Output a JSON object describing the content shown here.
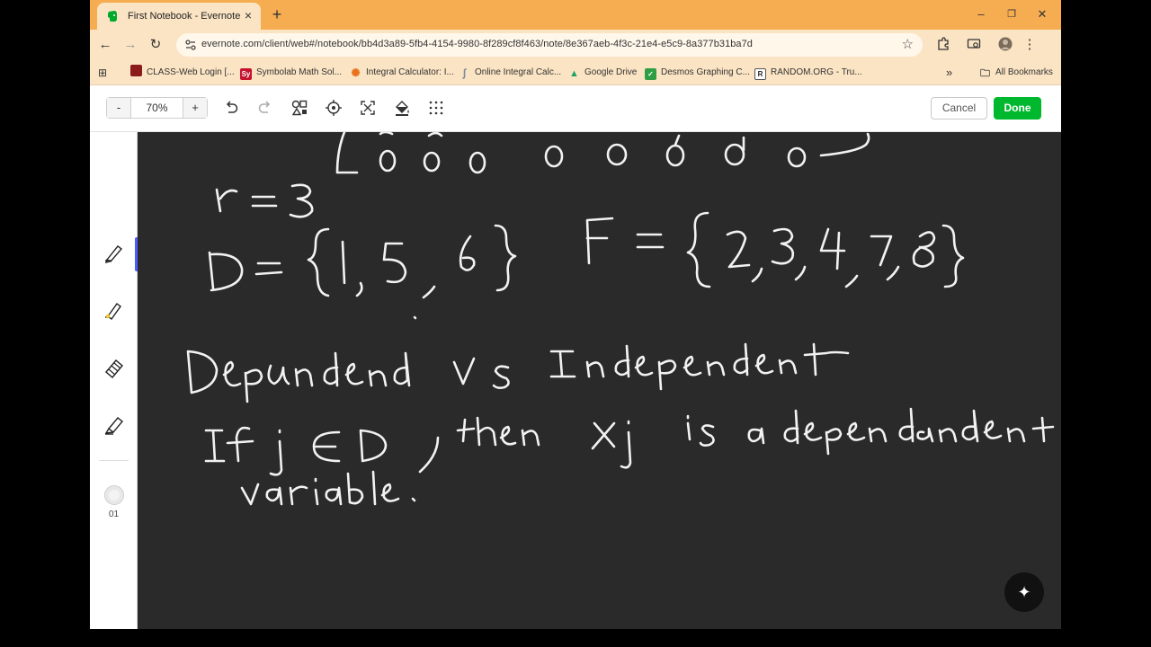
{
  "browser": {
    "tab_title": "First Notebook - Evernote",
    "url": "evernote.com/client/web#/notebook/bb4d3a89-5fb4-4154-9980-8f289cf8f463/note/8e367aeb-4f3c-21e4-e5c9-8a377b31ba7d",
    "window_controls": {
      "minimize": "–",
      "restore": "❐",
      "close": "✕"
    }
  },
  "bookmarks": {
    "items": [
      {
        "label": "CLASS-Web Login [...",
        "color": "#8c1b1b",
        "glyph": ""
      },
      {
        "label": "Symbolab Math Sol...",
        "color": "#c4122f",
        "glyph": "Sy"
      },
      {
        "label": "Integral Calculator: I...",
        "color": "#e8711c",
        "glyph": "✺"
      },
      {
        "label": "Online Integral Calc...",
        "color": "#9aa7b8",
        "glyph": "∫"
      },
      {
        "label": "Google Drive",
        "color": "#1fa463",
        "glyph": "▲"
      },
      {
        "label": "Desmos Graphing C...",
        "color": "#2f9e44",
        "glyph": "✓"
      },
      {
        "label": "RANDOM.ORG - Tru...",
        "color": "#ffffff",
        "glyph": "R"
      }
    ],
    "overflow": "»",
    "all_bookmarks": "All Bookmarks"
  },
  "sketch_toolbar": {
    "zoom_minus": "-",
    "zoom_value": "70%",
    "zoom_plus": "+",
    "cancel_label": "Cancel",
    "done_label": "Done"
  },
  "left_panel": {
    "page_number": "01"
  },
  "colors": {
    "tab_strip": "#f6ad52",
    "toolbar": "#fbe4c4",
    "canvas": "#2a2a2a",
    "done_button": "#00b82e",
    "active_tool": "#4d5cff"
  }
}
